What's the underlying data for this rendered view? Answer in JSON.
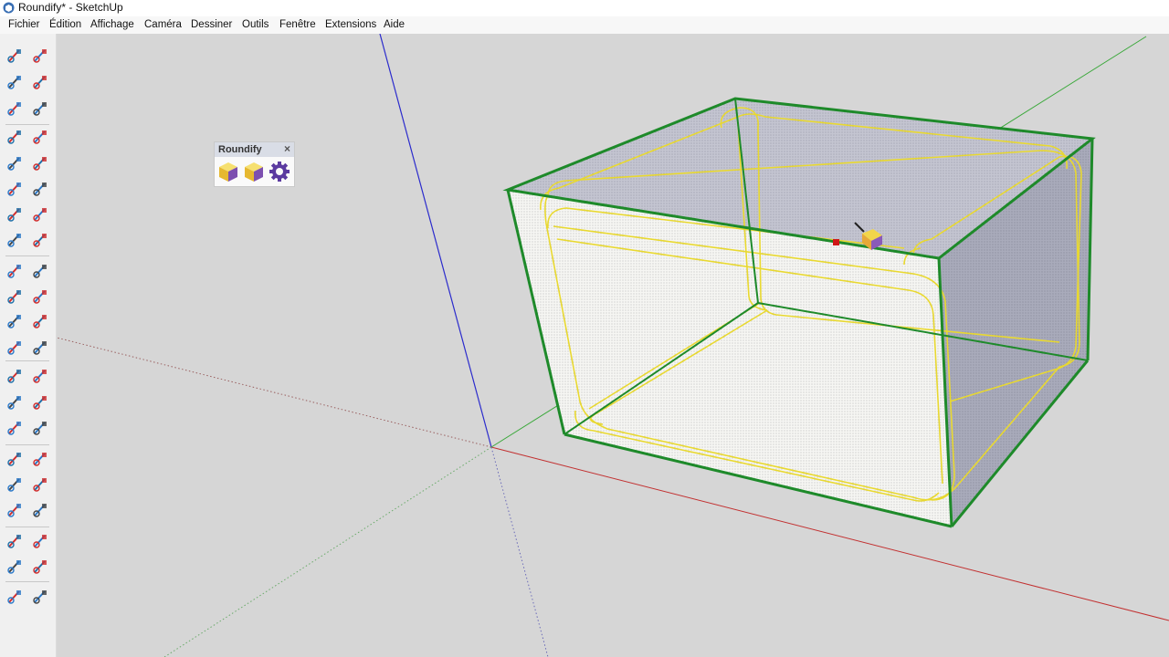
{
  "window": {
    "title": "Roundify* - SketchUp"
  },
  "menu": [
    "Fichier",
    "Édition",
    "Affichage",
    "Caméra",
    "Dessiner",
    "Outils",
    "Fenêtre",
    "Extensions",
    "Aide"
  ],
  "palette": {
    "title": "Roundify",
    "close": "×",
    "buttons": [
      "roundify-cube-icon",
      "roundify-cube-alt-icon",
      "roundify-settings-icon"
    ]
  },
  "toolbar_icons": [
    "select-icon",
    "lasso-icon",
    "paint-bucket-icon",
    "eraser-icon",
    "component-icon",
    "tag-eraser-icon",
    "line-icon",
    "freehand-icon",
    "rectangle-icon",
    "rotated-rectangle-icon",
    "circle-icon",
    "polygon-icon",
    "arc-icon",
    "two-point-arc-icon",
    "three-point-arc-icon",
    "pie-icon",
    "move-icon",
    "push-pull-icon",
    "rotate-icon",
    "follow-me-icon",
    "scale-icon",
    "offset-icon",
    "tape-measure-icon",
    "protractor-icon",
    "dimension-icon",
    "text-icon",
    "axes-icon",
    "3d-text-icon",
    "orbit-icon",
    "pan-icon",
    "zoom-icon",
    "zoom-window-icon",
    "zoom-extents-icon",
    "previous-view-icon",
    "position-camera-icon",
    "walk-icon",
    "look-around-icon",
    "section-plane-icon",
    "warehouse-icon",
    "extension-warehouse-icon",
    "layout-icon",
    "chat-icon"
  ],
  "colors": {
    "axis_blue": "#2b2bcc",
    "axis_red": "#c23030",
    "axis_green": "#3aa83a",
    "selection_green": "#1e8a2a",
    "roundify_yellow": "#e8d830"
  }
}
